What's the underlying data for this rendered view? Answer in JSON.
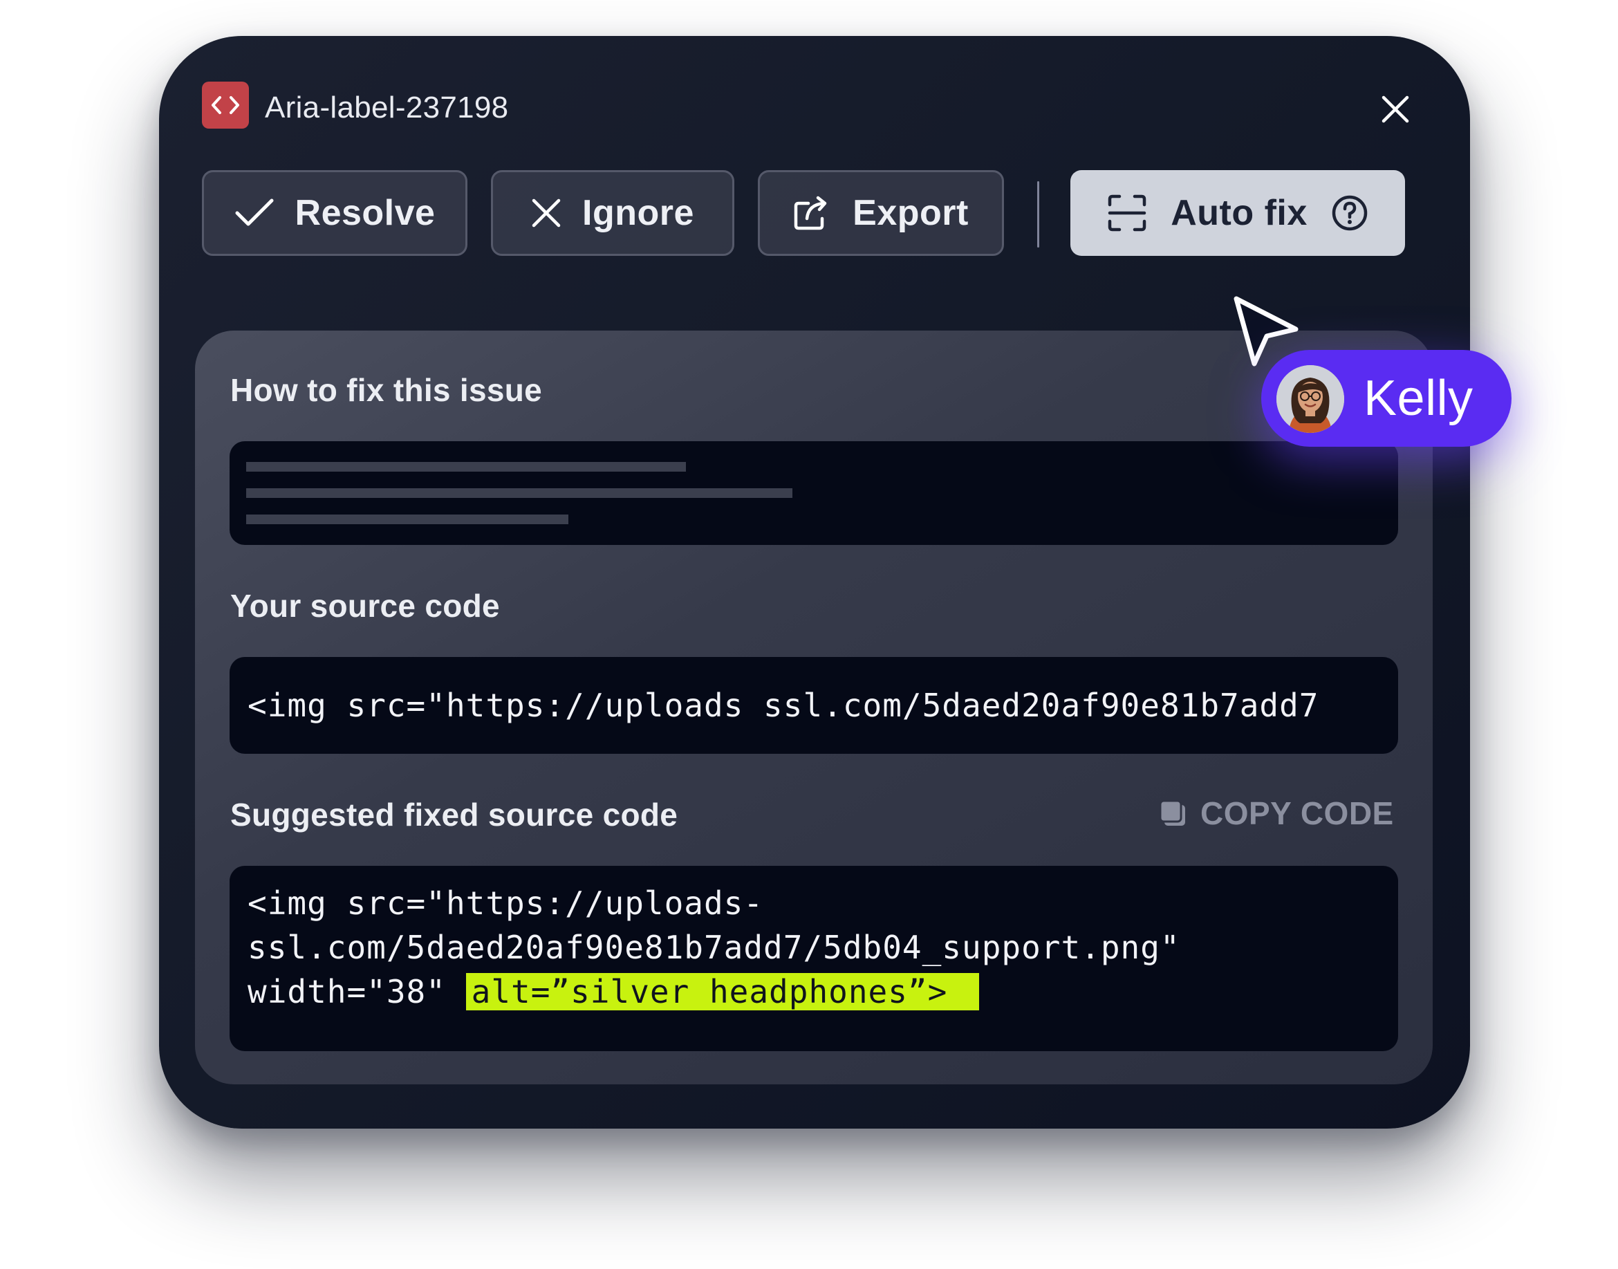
{
  "header": {
    "title": "Aria-label-237198",
    "badge_icon": "code-brackets-icon",
    "close_icon": "close-icon"
  },
  "toolbar": {
    "resolve_label": "Resolve",
    "ignore_label": "Ignore",
    "export_label": "Export",
    "autofix_label": "Auto fix"
  },
  "sections": {
    "how_to_fix_label": "How to fix this issue",
    "source_label": "Your source code",
    "suggested_label": "Suggested fixed source code",
    "copy_label": "COPY CODE"
  },
  "code": {
    "source_line": "<img src=\"https://uploads ssl.com/5daed20af90e81b7add7",
    "fixed_line_1": "<img src=\"https://uploads-",
    "fixed_line_2": "ssl.com/5daed20af90e81b7add7/5db04_support.png\"",
    "fixed_line_3_prefix": "width=\"38\" ",
    "fixed_line_3_highlight": "alt=”silver headphones”>"
  },
  "collaborator": {
    "name": "Kelly"
  },
  "colors": {
    "badge": "#c24248",
    "highlight": "#c8f20f",
    "pill": "#5a2cf2",
    "panel": "#141a29"
  }
}
